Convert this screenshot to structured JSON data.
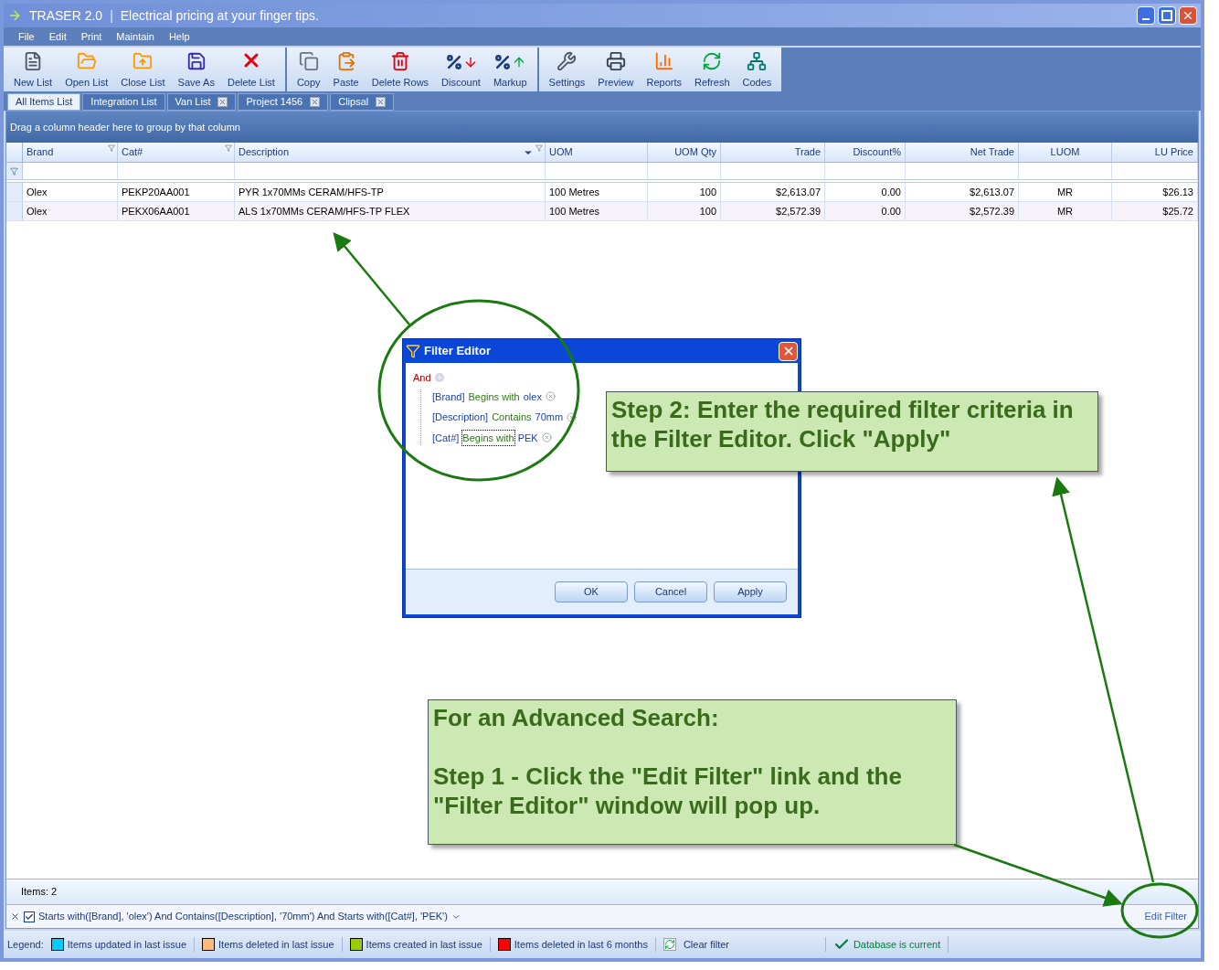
{
  "window": {
    "title": "TRASER 2.0",
    "separator": "|",
    "subtitle": "Electrical pricing at your finger tips."
  },
  "menu": [
    "File",
    "Edit",
    "Print",
    "Maintain",
    "Help"
  ],
  "toolbar": {
    "groups": [
      [
        {
          "label": "New List"
        },
        {
          "label": "Open List"
        },
        {
          "label": "Close List"
        },
        {
          "label": "Save As"
        },
        {
          "label": "Delete List"
        }
      ],
      [
        {
          "label": "Copy"
        },
        {
          "label": "Paste"
        },
        {
          "label": "Delete Rows"
        },
        {
          "label": "Discount"
        },
        {
          "label": "Markup"
        }
      ],
      [
        {
          "label": "Settings"
        },
        {
          "label": "Preview"
        },
        {
          "label": "Reports"
        },
        {
          "label": "Refresh"
        },
        {
          "label": "Codes"
        }
      ]
    ]
  },
  "tabs": [
    {
      "label": "All Items List",
      "selected": true,
      "closable": false
    },
    {
      "label": "Integration List",
      "selected": false,
      "closable": false
    },
    {
      "label": "Van List",
      "selected": false,
      "closable": true
    },
    {
      "label": "Project 1456",
      "selected": false,
      "closable": true
    },
    {
      "label": "Clipsal",
      "selected": false,
      "closable": true
    }
  ],
  "grid": {
    "group_panel": "Drag a column header here to group by that column",
    "columns": [
      {
        "label": "Brand",
        "filtered": true,
        "sorted": false
      },
      {
        "label": "Cat#",
        "filtered": true,
        "sorted": false
      },
      {
        "label": "Description",
        "filtered": true,
        "sorted": true
      },
      {
        "label": "UOM",
        "filtered": false,
        "sorted": false
      },
      {
        "label": "UOM Qty",
        "filtered": false,
        "sorted": false
      },
      {
        "label": "Trade",
        "filtered": false,
        "sorted": false
      },
      {
        "label": "Discount%",
        "filtered": false,
        "sorted": false
      },
      {
        "label": "Net Trade",
        "filtered": false,
        "sorted": false
      },
      {
        "label": "LUOM",
        "filtered": false,
        "sorted": false
      },
      {
        "label": "LU Price",
        "filtered": false,
        "sorted": false
      }
    ],
    "rows": [
      [
        "Olex",
        "PEKP20AA001",
        "PYR 1x70MMs CERAM/HFS-TP",
        "100 Metres",
        "100",
        "$2,613.07",
        "0.00",
        "$2,613.07",
        "MR",
        "$26.13"
      ],
      [
        "Olex",
        "PEKX06AA001",
        "ALS 1x70MMs CERAM/HFS-TP FLEX",
        "100 Metres",
        "100",
        "$2,572.39",
        "0.00",
        "$2,572.39",
        "MR",
        "$25.72"
      ]
    ],
    "footer": "Items: 2"
  },
  "filter_bar": {
    "enabled": true,
    "expression": "Starts with([Brand], 'olex') And Contains([Description], '70mm') And Starts with([Cat#], 'PEK')",
    "link": "Edit Filter"
  },
  "legend": {
    "label": "Legend:",
    "items": [
      {
        "label": "Items updated in last issue",
        "color": "#00ccff"
      },
      {
        "label": "Items deleted in last issue",
        "color": "#ffbb77"
      },
      {
        "label": "Items created in last issue",
        "color": "#99cc00"
      },
      {
        "label": "Items deleted in last 6 months",
        "color": "#ff0000"
      }
    ],
    "clear": "Clear filter",
    "status": "Database is current"
  },
  "filter_editor": {
    "title": "Filter Editor",
    "group": "And",
    "conditions": [
      {
        "field": "[Brand]",
        "operator": "Begins with",
        "value": "olex",
        "focused": false
      },
      {
        "field": "[Description]",
        "operator": "Contains",
        "value": "70mm",
        "focused": false
      },
      {
        "field": "[Cat#]",
        "operator": "Begins with",
        "value": "PEK",
        "focused": true
      }
    ],
    "buttons": [
      "OK",
      "Cancel",
      "Apply"
    ]
  },
  "callouts": [
    {
      "lines": [
        "Step 2: Enter the required filter criteria in the Filter Editor. Click \"Apply\""
      ]
    },
    {
      "lines": [
        "For an Advanced Search:",
        "Step 1 - Click the \"Edit Filter\" link and the \"Filter Editor\" window will pop up."
      ]
    }
  ]
}
